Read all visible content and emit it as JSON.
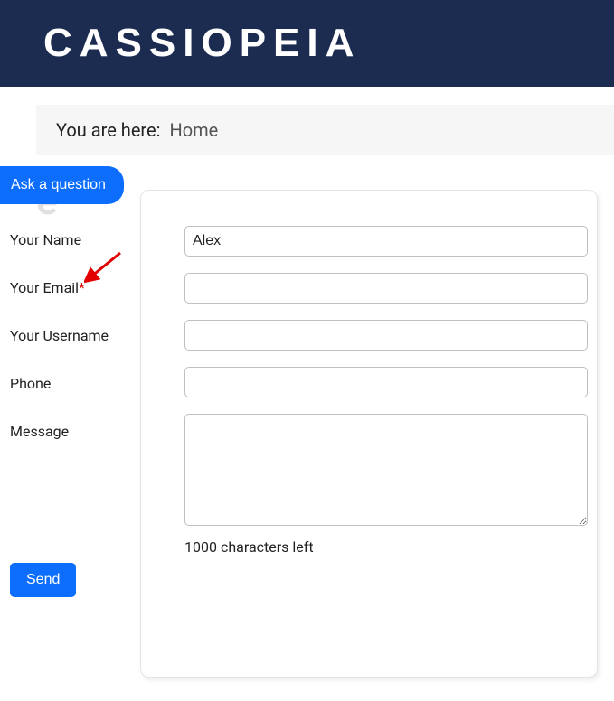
{
  "header": {
    "brand": "CASSIOPEIA"
  },
  "breadcrumb": {
    "label": "You are here:",
    "current": "Home"
  },
  "ask_button": "Ask a question",
  "background_title": "e",
  "form": {
    "labels": {
      "name": "Your Name",
      "email": "Your Email",
      "required_mark": "*",
      "username": "Your Username",
      "phone": "Phone",
      "message": "Message"
    },
    "values": {
      "name": "Alex",
      "email": "",
      "username": "",
      "phone": "",
      "message": ""
    },
    "counter": "1000 characters left",
    "send": "Send"
  }
}
